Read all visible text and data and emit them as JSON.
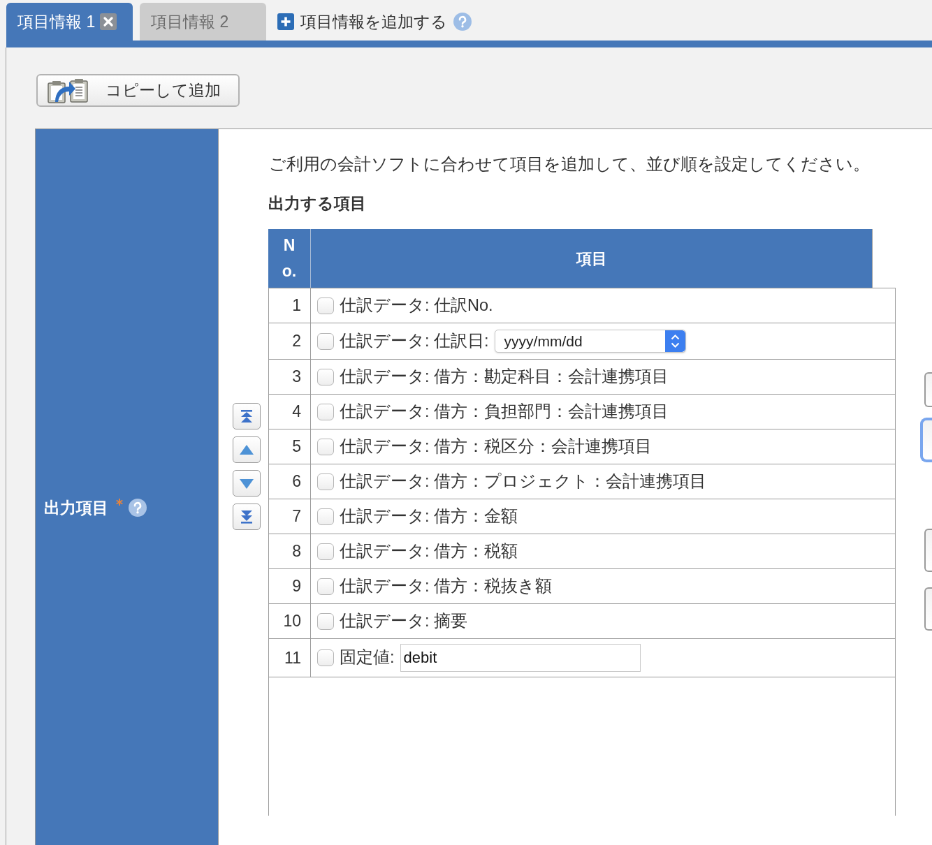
{
  "tabs": [
    {
      "label": "項目情報 1",
      "selected": true,
      "closable": true
    },
    {
      "label": "項目情報 2",
      "selected": false,
      "closable": false
    }
  ],
  "add_link": {
    "label": "項目情報を追加する"
  },
  "copy_button": {
    "label": "コピーして追加"
  },
  "field": {
    "label": "出力項目",
    "required": true
  },
  "instruction": "ご利用の会計ソフトに合わせて項目を追加して、並び順を設定してください。",
  "section_title": "出力する項目",
  "table": {
    "columns": [
      "No.",
      "項目"
    ],
    "rows": [
      {
        "no": "1",
        "label": "仕訳データ: 仕訳No.",
        "checked": false,
        "kind": "plain"
      },
      {
        "no": "2",
        "label": "仕訳データ: 仕訳日:",
        "checked": false,
        "kind": "select",
        "select": {
          "value": "yyyy/mm/dd"
        }
      },
      {
        "no": "3",
        "label": "仕訳データ: 借方：勘定科目：会計連携項目",
        "checked": false,
        "kind": "plain"
      },
      {
        "no": "4",
        "label": "仕訳データ: 借方：負担部門：会計連携項目",
        "checked": false,
        "kind": "plain"
      },
      {
        "no": "5",
        "label": "仕訳データ: 借方：税区分：会計連携項目",
        "checked": false,
        "kind": "plain"
      },
      {
        "no": "6",
        "label": "仕訳データ: 借方：プロジェクト：会計連携項目",
        "checked": false,
        "kind": "plain"
      },
      {
        "no": "7",
        "label": "仕訳データ: 借方：金額",
        "checked": false,
        "kind": "plain"
      },
      {
        "no": "8",
        "label": "仕訳データ: 借方：税額",
        "checked": false,
        "kind": "plain"
      },
      {
        "no": "9",
        "label": "仕訳データ: 借方：税抜き額",
        "checked": false,
        "kind": "plain"
      },
      {
        "no": "10",
        "label": "仕訳データ: 摘要",
        "checked": false,
        "kind": "plain"
      },
      {
        "no": "11",
        "label": "固定値:",
        "checked": false,
        "kind": "input",
        "input": {
          "value": "debit"
        }
      }
    ]
  },
  "side_buttons": [
    {
      "focused": false
    },
    {
      "focused": true
    },
    {
      "focused": false
    },
    {
      "focused": false
    }
  ]
}
